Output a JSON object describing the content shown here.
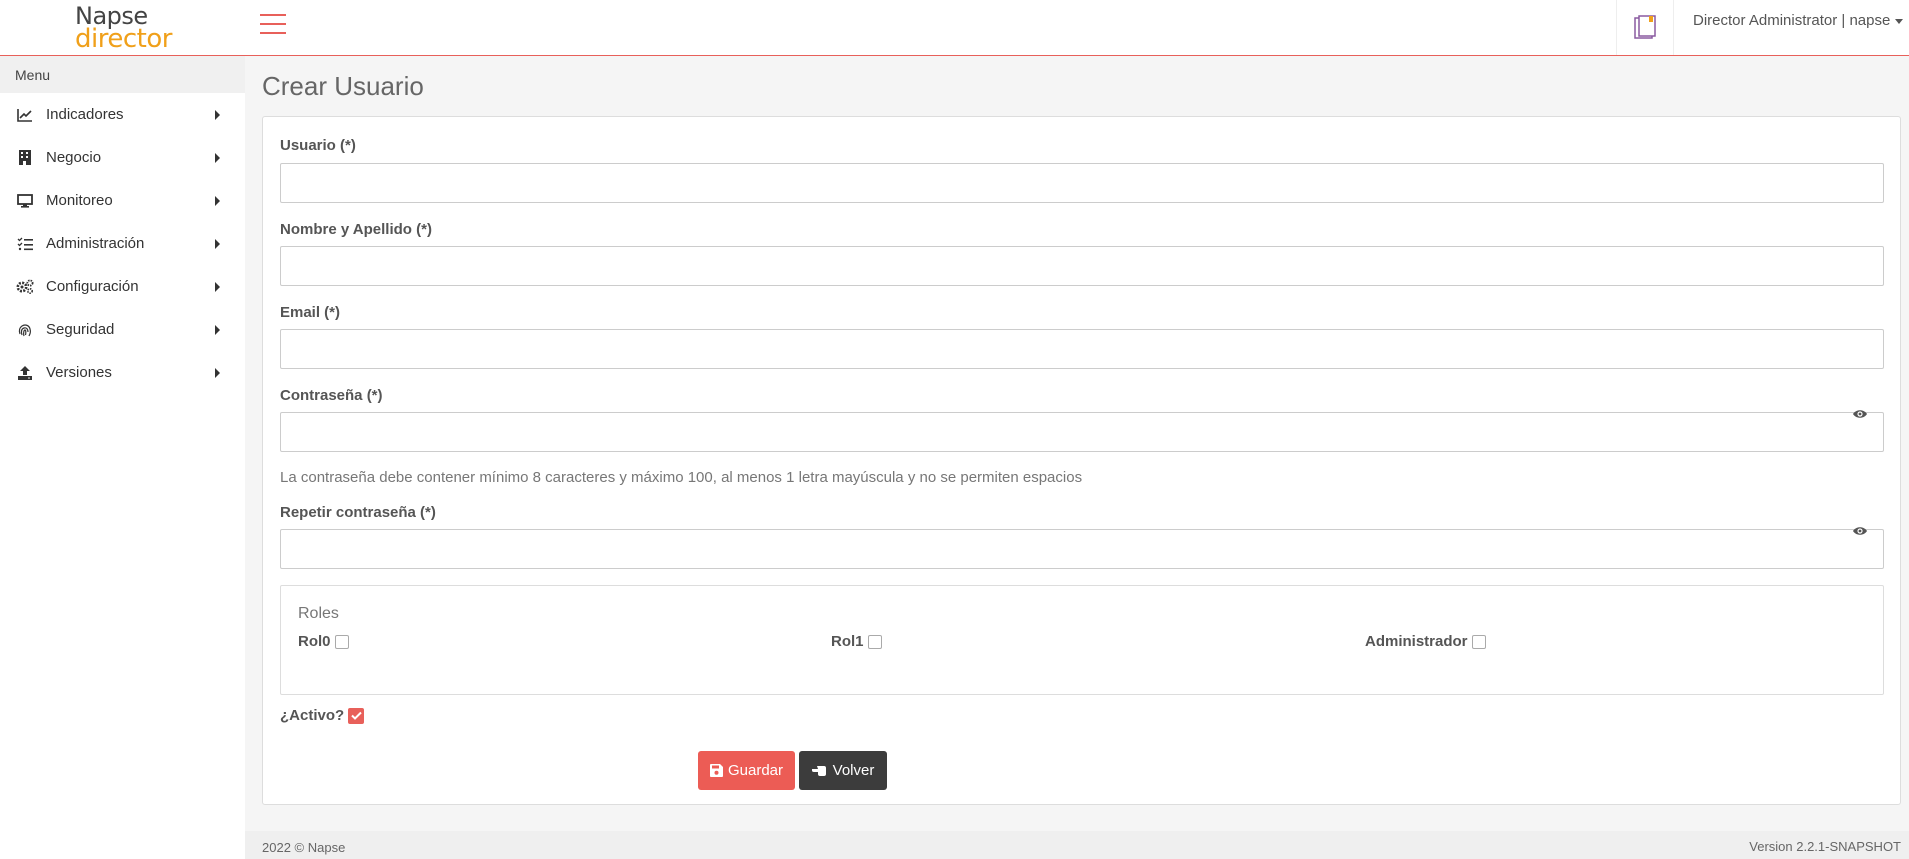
{
  "brand": {
    "line1": "Napse",
    "line2": "director"
  },
  "colors": {
    "accent": "#e8605a",
    "logo_orange": "#f0a01a",
    "dark_button": "#3c3c3c"
  },
  "header": {
    "user_label": "Director Administrator | napse",
    "notes_icon": "book-icon"
  },
  "sidebar": {
    "heading": "Menu",
    "items": [
      {
        "label": "Indicadores",
        "icon": "chart-line-icon"
      },
      {
        "label": "Negocio",
        "icon": "building-icon"
      },
      {
        "label": "Monitoreo",
        "icon": "desktop-icon"
      },
      {
        "label": "Administración",
        "icon": "tasks-icon"
      },
      {
        "label": "Configuración",
        "icon": "cogs-icon"
      },
      {
        "label": "Seguridad",
        "icon": "fingerprint-icon"
      },
      {
        "label": "Versiones",
        "icon": "upload-icon"
      }
    ]
  },
  "page": {
    "title": "Crear Usuario"
  },
  "form": {
    "usuario_label": "Usuario (*)",
    "usuario_value": "",
    "nombre_label": "Nombre y Apellido (*)",
    "nombre_value": "",
    "email_label": "Email (*)",
    "email_value": "",
    "password_label": "Contraseña (*)",
    "password_value": "",
    "password_help": "La contraseña debe contener mínimo 8 caracteres y máximo 100, al menos 1 letra mayúscula y no se permiten espacios",
    "repeat_label": "Repetir contraseña (*)",
    "repeat_value": "",
    "roles_legend": "Roles",
    "roles": [
      {
        "label": "Rol0",
        "checked": false
      },
      {
        "label": "Rol1",
        "checked": false
      },
      {
        "label": "Administrador",
        "checked": false
      }
    ],
    "activo_label": "¿Activo?",
    "activo_checked": true,
    "save_label": "Guardar",
    "back_label": "Volver"
  },
  "footer": {
    "copyright": "2022 © Napse",
    "version": "Version 2.2.1-SNAPSHOT"
  }
}
